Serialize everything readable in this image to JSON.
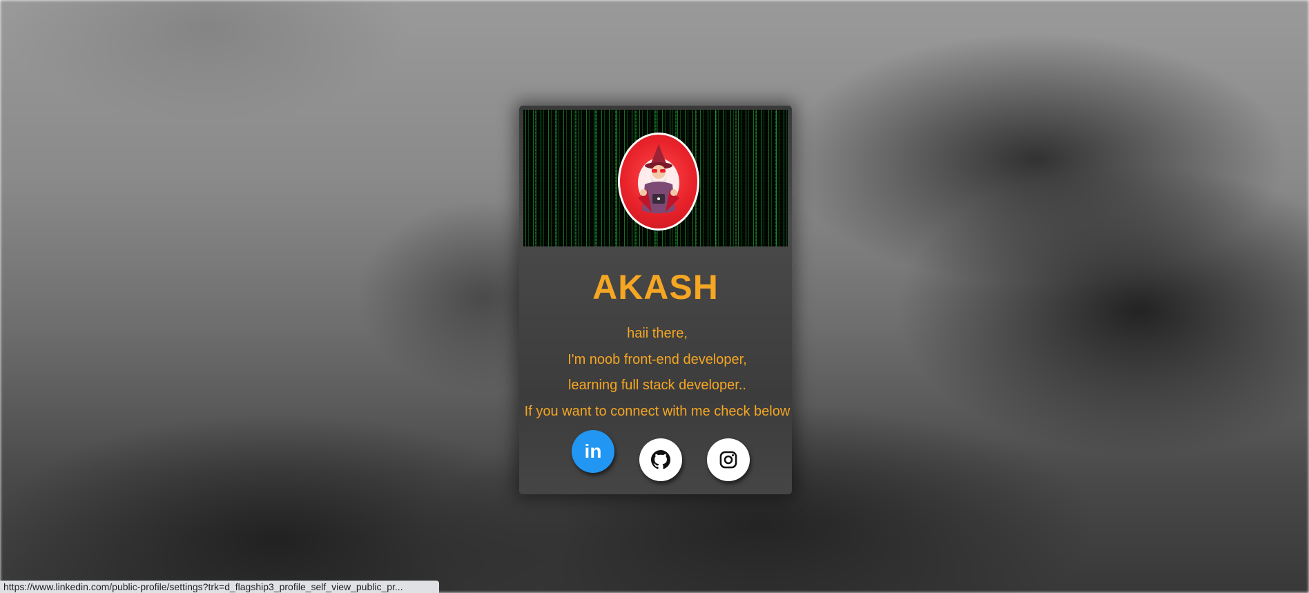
{
  "profile": {
    "name": "AKASH",
    "bio": [
      "haii there,",
      "I'm noob front-end developer,",
      "learning full stack developer..",
      "If you want to connect with me check below"
    ]
  },
  "social": {
    "linkedin": {
      "label": "in",
      "icon": "linkedin-icon",
      "color": "#2196f3"
    },
    "github": {
      "icon": "github-icon",
      "color": "#ffffff"
    },
    "instagram": {
      "icon": "instagram-icon",
      "color": "#ffffff"
    }
  },
  "status_bar": {
    "url": "https://www.linkedin.com/public-profile/settings?trk=d_flagship3_profile_self_view_public_pr..."
  },
  "colors": {
    "accent": "#f5a623",
    "card_bg": "#3f3f3f",
    "avatar_bg": "#e8222a"
  }
}
